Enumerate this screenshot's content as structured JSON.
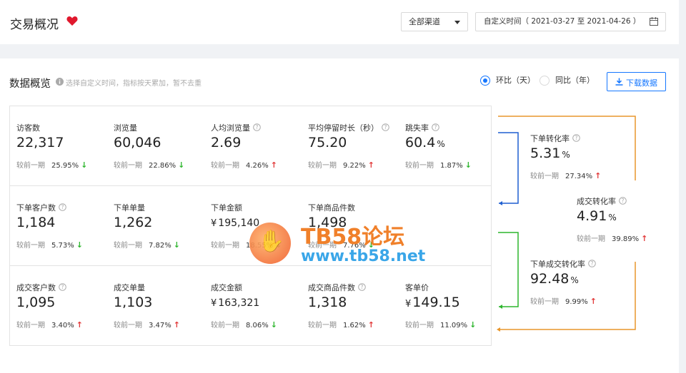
{
  "header": {
    "title": "交易概况",
    "channel": "全部渠道",
    "date_range": "自定义时间（ 2021-03-27 至 2021-04-26 ）"
  },
  "overview": {
    "title": "数据概览",
    "hint": "选择自定义时间，指标按天累加，暂不去重",
    "compare_options": [
      {
        "label": "环比（天）",
        "checked": true
      },
      {
        "label": "同比（年）",
        "checked": false
      }
    ],
    "download_label": "下载数据"
  },
  "compare_prefix": "较前一期",
  "metrics": [
    {
      "label": "访客数",
      "help": false,
      "value": "22,317",
      "pct": "25.95%",
      "trend": "down"
    },
    {
      "label": "浏览量",
      "help": false,
      "value": "60,046",
      "pct": "22.86%",
      "trend": "down"
    },
    {
      "label": "人均浏览量",
      "help": true,
      "value": "2.69",
      "pct": "4.26%",
      "trend": "up"
    },
    {
      "label": "平均停留时长（秒）",
      "help": true,
      "value": "75.20",
      "pct": "9.22%",
      "trend": "up"
    },
    {
      "label": "跳失率",
      "help": true,
      "value": "60.4",
      "unit": "%",
      "pct": "1.87%",
      "trend": "down"
    },
    {
      "label": "下单客户数",
      "help": true,
      "value": "1,184",
      "pct": "5.73%",
      "trend": "down"
    },
    {
      "label": "下单单量",
      "help": false,
      "value": "1,262",
      "pct": "7.82%",
      "trend": "down"
    },
    {
      "label": "下单金额",
      "help": false,
      "currency": "¥",
      "value": "195,140",
      "pct": "18.55%",
      "trend": "down",
      "small": true
    },
    {
      "label": "下单商品件数",
      "help": false,
      "value": "1,498",
      "pct": "7.76%",
      "trend": "down"
    },
    {
      "label": "成交客户数",
      "help": true,
      "value": "1,095",
      "pct": "3.40%",
      "trend": "up"
    },
    {
      "label": "成交单量",
      "help": false,
      "value": "1,103",
      "pct": "3.47%",
      "trend": "up"
    },
    {
      "label": "成交金额",
      "help": false,
      "currency": "¥",
      "value": "163,321",
      "pct": "8.06%",
      "trend": "down",
      "small": true
    },
    {
      "label": "成交商品件数",
      "help": true,
      "value": "1,318",
      "pct": "1.62%",
      "trend": "up"
    },
    {
      "label": "客单价",
      "help": false,
      "currency": "¥",
      "value": "149.15",
      "pct": "11.09%",
      "trend": "down"
    }
  ],
  "funnel": [
    {
      "label": "下单转化率",
      "value": "5.31",
      "unit": "%",
      "pct": "27.34%",
      "trend": "up"
    },
    {
      "label": "成交转化率",
      "value": "4.91",
      "unit": "%",
      "pct": "39.89%",
      "trend": "up"
    },
    {
      "label": "下单成交转化率",
      "value": "92.48",
      "unit": "%",
      "pct": "9.99%",
      "trend": "up"
    }
  ],
  "colors": {
    "accent": "#1677ff",
    "up": "#e23a3a",
    "down": "#2db52d",
    "funnel_orange": "#e8962c",
    "funnel_blue": "#1f5fd1",
    "funnel_green": "#2db52d"
  },
  "watermark": {
    "title": "TB58论坛",
    "url": "www.tb58.net"
  }
}
